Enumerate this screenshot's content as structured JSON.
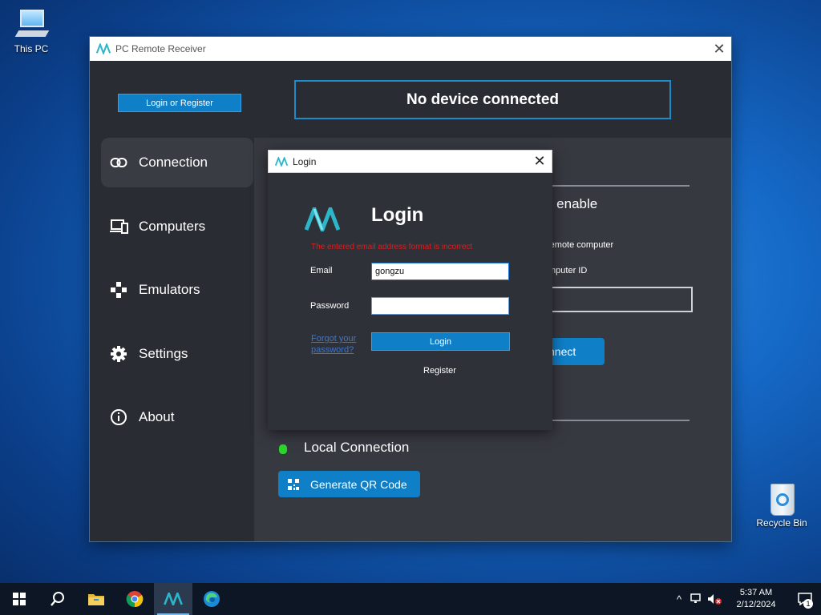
{
  "desktop": {
    "icons": [
      {
        "label": "This PC"
      },
      {
        "label": "Recycle Bin"
      }
    ]
  },
  "window": {
    "title": "PC Remote Receiver",
    "login_register_label": "Login or Register",
    "device_status": "No device connected"
  },
  "sidebar": {
    "items": [
      {
        "label": "Connection",
        "icon": "link-icon",
        "active": true
      },
      {
        "label": "Computers",
        "icon": "computers-icon"
      },
      {
        "label": "Emulators",
        "icon": "gamepad-icon"
      },
      {
        "label": "Settings",
        "icon": "gear-icon"
      },
      {
        "label": "About",
        "icon": "info-icon"
      }
    ]
  },
  "content": {
    "partial_heading": "o enable",
    "partial_line1": "remote computer",
    "partial_line2": "mputer ID",
    "connect_label": "nnect",
    "local_connection_label": "Local Connection",
    "qr_button_label": "Generate QR Code"
  },
  "login_dialog": {
    "title": "Login",
    "heading": "Login",
    "error": "The entered email address format is incorrect",
    "email_label": "Email",
    "email_value": "gongzu",
    "password_label": "Password",
    "password_value": "",
    "forgot_label": "Forgot your password?",
    "login_button": "Login",
    "register_label": "Register"
  },
  "taskbar": {
    "time": "5:37 AM",
    "date": "2/12/2024",
    "notification_count": "1"
  },
  "colors": {
    "accent": "#0f7fc8",
    "error": "#e01c1c",
    "status_green": "#2bd62b",
    "panel": "#2a2c33"
  }
}
